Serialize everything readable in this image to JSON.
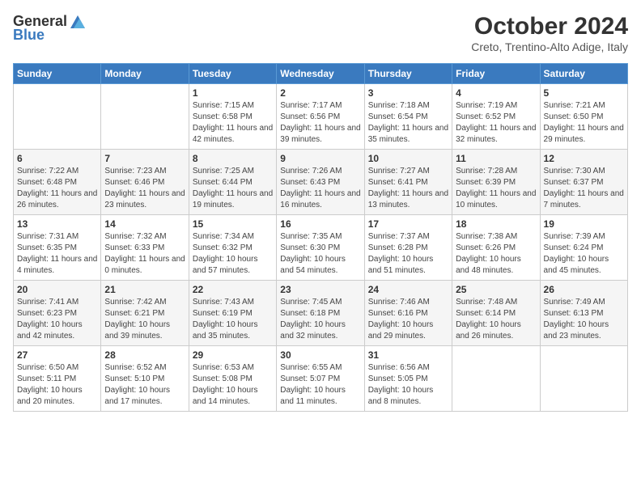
{
  "logo": {
    "general": "General",
    "blue": "Blue"
  },
  "title": "October 2024",
  "location": "Creto, Trentino-Alto Adige, Italy",
  "days_of_week": [
    "Sunday",
    "Monday",
    "Tuesday",
    "Wednesday",
    "Thursday",
    "Friday",
    "Saturday"
  ],
  "weeks": [
    [
      {
        "day": "",
        "info": ""
      },
      {
        "day": "",
        "info": ""
      },
      {
        "day": "1",
        "info": "Sunrise: 7:15 AM\nSunset: 6:58 PM\nDaylight: 11 hours and 42 minutes."
      },
      {
        "day": "2",
        "info": "Sunrise: 7:17 AM\nSunset: 6:56 PM\nDaylight: 11 hours and 39 minutes."
      },
      {
        "day": "3",
        "info": "Sunrise: 7:18 AM\nSunset: 6:54 PM\nDaylight: 11 hours and 35 minutes."
      },
      {
        "day": "4",
        "info": "Sunrise: 7:19 AM\nSunset: 6:52 PM\nDaylight: 11 hours and 32 minutes."
      },
      {
        "day": "5",
        "info": "Sunrise: 7:21 AM\nSunset: 6:50 PM\nDaylight: 11 hours and 29 minutes."
      }
    ],
    [
      {
        "day": "6",
        "info": "Sunrise: 7:22 AM\nSunset: 6:48 PM\nDaylight: 11 hours and 26 minutes."
      },
      {
        "day": "7",
        "info": "Sunrise: 7:23 AM\nSunset: 6:46 PM\nDaylight: 11 hours and 23 minutes."
      },
      {
        "day": "8",
        "info": "Sunrise: 7:25 AM\nSunset: 6:44 PM\nDaylight: 11 hours and 19 minutes."
      },
      {
        "day": "9",
        "info": "Sunrise: 7:26 AM\nSunset: 6:43 PM\nDaylight: 11 hours and 16 minutes."
      },
      {
        "day": "10",
        "info": "Sunrise: 7:27 AM\nSunset: 6:41 PM\nDaylight: 11 hours and 13 minutes."
      },
      {
        "day": "11",
        "info": "Sunrise: 7:28 AM\nSunset: 6:39 PM\nDaylight: 11 hours and 10 minutes."
      },
      {
        "day": "12",
        "info": "Sunrise: 7:30 AM\nSunset: 6:37 PM\nDaylight: 11 hours and 7 minutes."
      }
    ],
    [
      {
        "day": "13",
        "info": "Sunrise: 7:31 AM\nSunset: 6:35 PM\nDaylight: 11 hours and 4 minutes."
      },
      {
        "day": "14",
        "info": "Sunrise: 7:32 AM\nSunset: 6:33 PM\nDaylight: 11 hours and 0 minutes."
      },
      {
        "day": "15",
        "info": "Sunrise: 7:34 AM\nSunset: 6:32 PM\nDaylight: 10 hours and 57 minutes."
      },
      {
        "day": "16",
        "info": "Sunrise: 7:35 AM\nSunset: 6:30 PM\nDaylight: 10 hours and 54 minutes."
      },
      {
        "day": "17",
        "info": "Sunrise: 7:37 AM\nSunset: 6:28 PM\nDaylight: 10 hours and 51 minutes."
      },
      {
        "day": "18",
        "info": "Sunrise: 7:38 AM\nSunset: 6:26 PM\nDaylight: 10 hours and 48 minutes."
      },
      {
        "day": "19",
        "info": "Sunrise: 7:39 AM\nSunset: 6:24 PM\nDaylight: 10 hours and 45 minutes."
      }
    ],
    [
      {
        "day": "20",
        "info": "Sunrise: 7:41 AM\nSunset: 6:23 PM\nDaylight: 10 hours and 42 minutes."
      },
      {
        "day": "21",
        "info": "Sunrise: 7:42 AM\nSunset: 6:21 PM\nDaylight: 10 hours and 39 minutes."
      },
      {
        "day": "22",
        "info": "Sunrise: 7:43 AM\nSunset: 6:19 PM\nDaylight: 10 hours and 35 minutes."
      },
      {
        "day": "23",
        "info": "Sunrise: 7:45 AM\nSunset: 6:18 PM\nDaylight: 10 hours and 32 minutes."
      },
      {
        "day": "24",
        "info": "Sunrise: 7:46 AM\nSunset: 6:16 PM\nDaylight: 10 hours and 29 minutes."
      },
      {
        "day": "25",
        "info": "Sunrise: 7:48 AM\nSunset: 6:14 PM\nDaylight: 10 hours and 26 minutes."
      },
      {
        "day": "26",
        "info": "Sunrise: 7:49 AM\nSunset: 6:13 PM\nDaylight: 10 hours and 23 minutes."
      }
    ],
    [
      {
        "day": "27",
        "info": "Sunrise: 6:50 AM\nSunset: 5:11 PM\nDaylight: 10 hours and 20 minutes."
      },
      {
        "day": "28",
        "info": "Sunrise: 6:52 AM\nSunset: 5:10 PM\nDaylight: 10 hours and 17 minutes."
      },
      {
        "day": "29",
        "info": "Sunrise: 6:53 AM\nSunset: 5:08 PM\nDaylight: 10 hours and 14 minutes."
      },
      {
        "day": "30",
        "info": "Sunrise: 6:55 AM\nSunset: 5:07 PM\nDaylight: 10 hours and 11 minutes."
      },
      {
        "day": "31",
        "info": "Sunrise: 6:56 AM\nSunset: 5:05 PM\nDaylight: 10 hours and 8 minutes."
      },
      {
        "day": "",
        "info": ""
      },
      {
        "day": "",
        "info": ""
      }
    ]
  ]
}
